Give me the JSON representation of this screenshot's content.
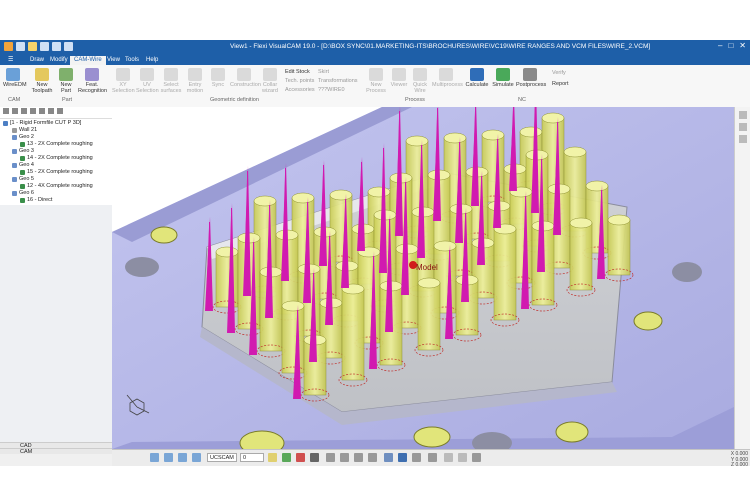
{
  "app": {
    "title": "View1 - Flexi VisualCAM 19.0 - [D:\\BOX SYNC\\01.MARKETING-ITS\\BROCHURES\\WIRE\\VC19\\WIRE RANGES AND VCM FILES\\WIRE_2.VCM]"
  },
  "menu": {
    "tabs": [
      "File",
      "Draw",
      "Modify",
      "CAM-Wire",
      "View",
      "Tools",
      "Help"
    ],
    "active": "CAM-Wire"
  },
  "ribbon": {
    "groups": [
      "CAM",
      "Part",
      "Geometric definition",
      "Process",
      "NC"
    ],
    "buttons": {
      "wire_edm": "WireEDM",
      "new_toolpath": "New Toolpath",
      "new_part": "New Part",
      "feat_recognition": "Feat. Recognition",
      "xy_selection": "XY Selection",
      "uv_selection": "UV Selection",
      "select_surfaces": "Select surfaces",
      "entry_motion": "Entry motion",
      "sync": "Sync",
      "construction": "Construction",
      "collar_wizard": "Collar wizard",
      "edit_stock": "Edit Stock",
      "skirt": "Skirt",
      "tech_points": "Tech. points",
      "transformations": "Transformations",
      "accessories": "Accessories",
      "process_value": "???WIRE0",
      "new_process": "New Process",
      "viewer": "Viewer",
      "quick_wire": "Quick Wire",
      "multiprocess": "Multiprocess",
      "calculate": "Calculate",
      "simulate": "Simulate",
      "postprocess": "Postprocess",
      "verify": "Verify",
      "report": "Report"
    }
  },
  "tree": {
    "root": "[1 - Rigid Formfile CUT P 3D]",
    "items": [
      "Wall 21",
      "Geo 2",
      "13 - 2X Complete roughing",
      "Geo 3",
      "14 - 2X Complete roughing",
      "Geo 4",
      "15 - 2X Complete roughing",
      "Geo 5",
      "12 - 4X Complete roughing",
      "Geo 6",
      "16 - Direct"
    ]
  },
  "left_tabs": [
    "CAD",
    "CAM"
  ],
  "viewport": {
    "label": "Model"
  },
  "bottom": {
    "dropdown1": "UCSCAM",
    "dropdown2": "0",
    "coords": [
      "X 0.000",
      "Y 0.000",
      "Z 0.000"
    ]
  },
  "colors": {
    "title_bar": "#1e5fa8",
    "part_face": "#b4b6e6",
    "cylinder": "#e1e57a",
    "wire_path": "#d11bb0",
    "dashed": "#c0312d"
  }
}
